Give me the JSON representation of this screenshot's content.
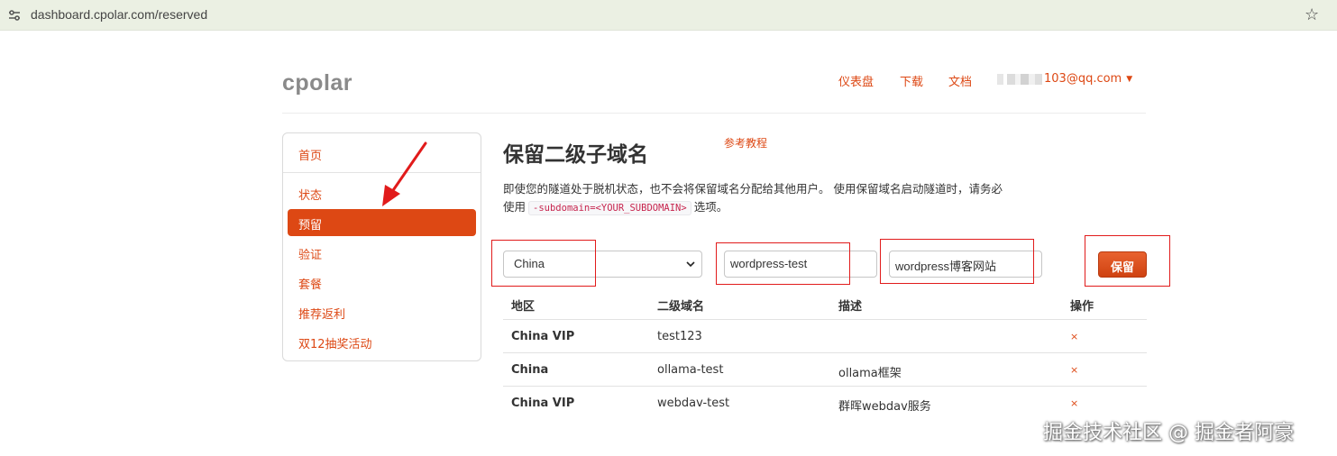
{
  "browser": {
    "url": "dashboard.cpolar.com/reserved"
  },
  "header": {
    "logo": "cpolar",
    "nav": [
      {
        "label": "仪表盘"
      },
      {
        "label": "下载"
      },
      {
        "label": "文档"
      }
    ],
    "user_email": "103@qq.com"
  },
  "sidebar": {
    "items": [
      {
        "label": "首页"
      },
      {
        "label": "状态"
      },
      {
        "label": "预留"
      },
      {
        "label": "验证"
      },
      {
        "label": "套餐"
      },
      {
        "label": "推荐返利"
      },
      {
        "label": "双12抽奖活动"
      }
    ],
    "active": "预留"
  },
  "main": {
    "title": "保留二级子域名",
    "tutorial_link": "参考教程",
    "description_pre": "即使您的隧道处于脱机状态，也不会将保留域名分配给其他用户。 使用保留域名启动隧道时，请务必使用",
    "description_code": "-subdomain=<YOUR_SUBDOMAIN>",
    "description_post": "选项。",
    "form": {
      "region_value": "China",
      "subdomain_value": "wordpress-test",
      "description_value": "wordpress博客网站",
      "save_label": "保留"
    },
    "table": {
      "headers": {
        "region": "地区",
        "subdomain": "二级域名",
        "description": "描述",
        "action": "操作"
      },
      "rows": [
        {
          "region": "China VIP",
          "subdomain": "test123",
          "description": "",
          "action": "×"
        },
        {
          "region": "China",
          "subdomain": "ollama-test",
          "description": "ollama框架",
          "action": "×"
        },
        {
          "region": "China VIP",
          "subdomain": "webdav-test",
          "description": "群晖webdav服务",
          "action": "×"
        }
      ]
    }
  },
  "watermark": "掘金技术社区 @ 掘金者阿豪",
  "colors": {
    "accent": "#dd4814",
    "annotation": "#e11b1b",
    "address_bar": "#ebf0e3"
  }
}
